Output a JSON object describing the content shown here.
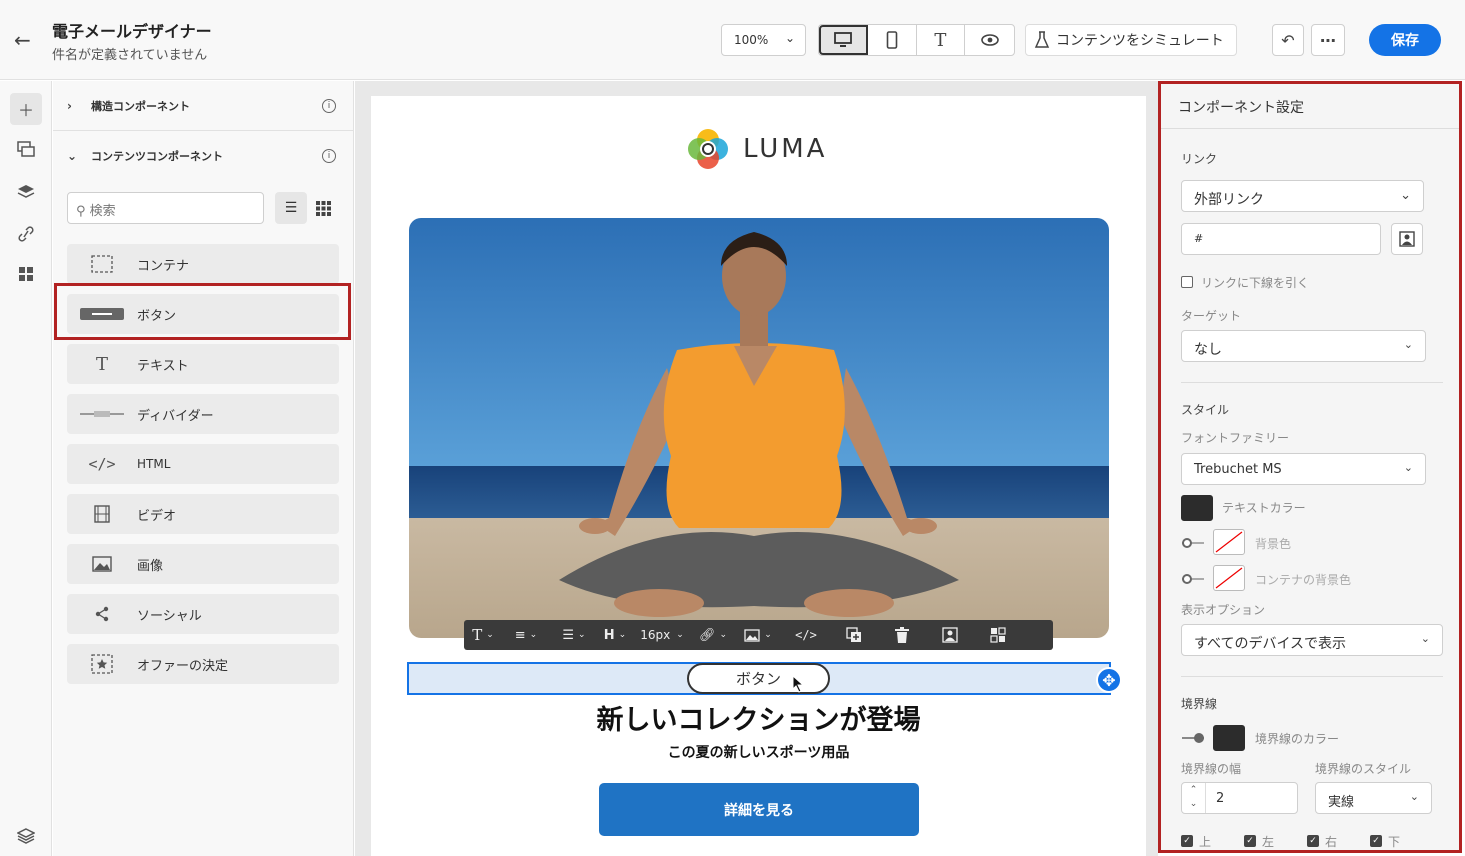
{
  "header": {
    "title": "電子メールデザイナー",
    "subtitle": "件名が定義されていません",
    "zoom": "100%",
    "simulate_label": "コンテンツをシミュレート",
    "save_label": "保存"
  },
  "components": {
    "structure_label": "構造コンポーネント",
    "content_label": "コンテンツコンポーネント",
    "search_placeholder": "検索",
    "items": [
      {
        "label": "コンテナ",
        "icon": "container-icon"
      },
      {
        "label": "ボタン",
        "icon": "button-icon"
      },
      {
        "label": "テキスト",
        "icon": "text-icon"
      },
      {
        "label": "ディバイダー",
        "icon": "divider-icon"
      },
      {
        "label": "HTML",
        "icon": "code-icon"
      },
      {
        "label": "ビデオ",
        "icon": "video-icon"
      },
      {
        "label": "画像",
        "icon": "image-icon"
      },
      {
        "label": "ソーシャル",
        "icon": "share-icon"
      },
      {
        "label": "オファーの決定",
        "icon": "offer-icon"
      }
    ]
  },
  "canvas": {
    "logo_text": "LUMA",
    "toolbar_font_size": "16px",
    "toolbar_heading": "H",
    "button_label": "ボタン",
    "headline": "新しいコレクションが登場",
    "subheadline": "この夏の新しいスポーツ用品",
    "cta_label": "詳細を見る"
  },
  "properties": {
    "title": "コンポーネント設定",
    "link_label": "リンク",
    "link_type": "外部リンク",
    "link_url": "#",
    "underline_label": "リンクに下線を引く",
    "target_label": "ターゲット",
    "target_value": "なし",
    "style_label": "スタイル",
    "font_family_label": "フォントファミリー",
    "font_family_value": "Trebuchet MS",
    "text_color_label": "テキストカラー",
    "bg_color_label": "背景色",
    "container_bg_label": "コンテナの背景色",
    "display_option_label": "表示オプション",
    "display_option_value": "すべてのデバイスで表示",
    "border_label": "境界線",
    "border_color_label": "境界線のカラー",
    "border_width_label": "境界線の幅",
    "border_width_value": "2",
    "border_style_label": "境界線のスタイル",
    "border_style_value": "実線",
    "side_top": "上",
    "side_left": "左",
    "side_right": "右",
    "side_bottom": "下"
  },
  "colors": {
    "accent": "#1473e6",
    "cta": "#1f73c4",
    "highlight": "#b22222",
    "text_color": "#2c2c2c"
  }
}
